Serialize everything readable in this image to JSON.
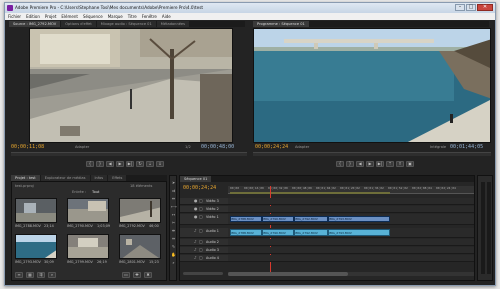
{
  "titlebar": {
    "title": "Adobe Premiere Pro - C:\\Users\\Stephane Tosi\\Mes documents\\Adobe\\Premiere Pro\\4.0\\test"
  },
  "menu": [
    "Fichier",
    "Edition",
    "Projet",
    "Elément",
    "Séquence",
    "Marque",
    "Titre",
    "Fenêtre",
    "Aide"
  ],
  "source_monitor": {
    "tabs": [
      "Source : IMG_2792.MOV",
      "Options d'effet",
      "Mixage audio : Séquence 01",
      "Métadonnées"
    ],
    "timecode_in": "00;00;11;08",
    "zoom": "Adapter",
    "duration": "00;00;48;00",
    "fraction": "1/2"
  },
  "program_monitor": {
    "tabs": [
      "Programme : Séquence 01"
    ],
    "timecode_in": "00;00;24;24",
    "zoom": "Adapter",
    "duration": "00;01;44;05",
    "quality": "Intégrale"
  },
  "project": {
    "tabs": [
      "Projet : test",
      "Explorateur de médias",
      "Infos",
      "Effets",
      "Marques",
      "Hist"
    ],
    "project_name": "test.prproj",
    "items_count": "18 éléments",
    "search_label": "Entrée :",
    "search_value": "Tout",
    "items": [
      {
        "label": "IMG_2788.MOV",
        "duration": "23;14"
      },
      {
        "label": "IMG_2790.MOV",
        "duration": "1;03;09"
      },
      {
        "label": "IMG_2792.MOV",
        "duration": "46;00"
      },
      {
        "label": "IMG_2793.MOV",
        "duration": "30;09"
      },
      {
        "label": "IMG_2799.MOV",
        "duration": "26;19"
      },
      {
        "label": "IMG_2801.MOV",
        "duration": "15;23"
      }
    ]
  },
  "timeline": {
    "tabs": [
      "Séquence 01"
    ],
    "timecode": "00;00;24;24",
    "ruler_labels": [
      "00;00",
      "00;00;16;00",
      "00;00;32;00",
      "00;00;48;00",
      "00;01;04;02",
      "00;01;20;02",
      "00;01;36;02",
      "00;01;52;02",
      "00;02;08;04",
      "00;02;24;04"
    ],
    "video_tracks": [
      "Vidéo 3",
      "Vidéo 2",
      "Vidéo 1"
    ],
    "audio_tracks": [
      "Audio 1",
      "Audio 2",
      "Audio 3",
      "Audio 4"
    ],
    "video_clips": [
      "IMG_2788.MOV",
      "IMG_2790.MOV",
      "IMG_2792.MOV",
      "IMG_2793.MOV"
    ],
    "audio_clips": [
      "IMG_2788.MOV",
      "IMG_2790.MOV",
      "IMG_2792.MOV",
      "IMG_2793.MOV"
    ]
  },
  "colors": {
    "timecode": "#e9a72f",
    "video_clip": "#6b90c3",
    "audio_clip": "#58b2d6",
    "panel_bg": "#232323"
  }
}
